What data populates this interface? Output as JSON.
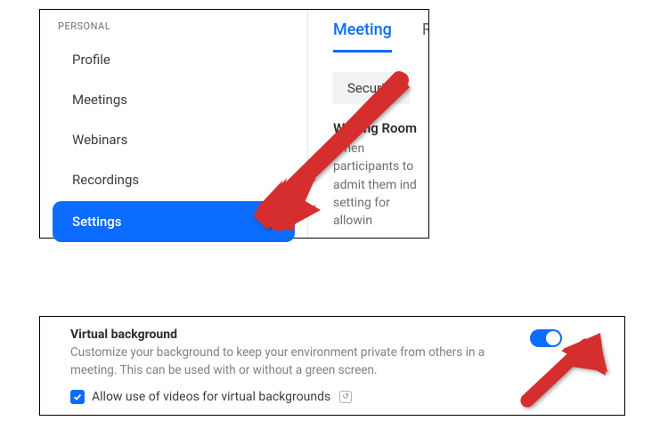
{
  "sidebar": {
    "section_label": "PERSONAL",
    "items": [
      {
        "label": "Profile"
      },
      {
        "label": "Meetings"
      },
      {
        "label": "Webinars"
      },
      {
        "label": "Recordings"
      },
      {
        "label": "Settings"
      }
    ]
  },
  "tabs": {
    "meeting": "Meeting",
    "recording_partial": "Re"
  },
  "content": {
    "section_link": "Security",
    "waiting_room_title": "Waiting Room",
    "waiting_room_desc": "When participants to admit them ind setting for allowin"
  },
  "vb": {
    "title": "Virtual background",
    "desc": "Customize your background to keep your environment private from others in a meeting. This can be used with or without a green screen.",
    "allow_videos": "Allow use of videos for virtual backgrounds"
  }
}
